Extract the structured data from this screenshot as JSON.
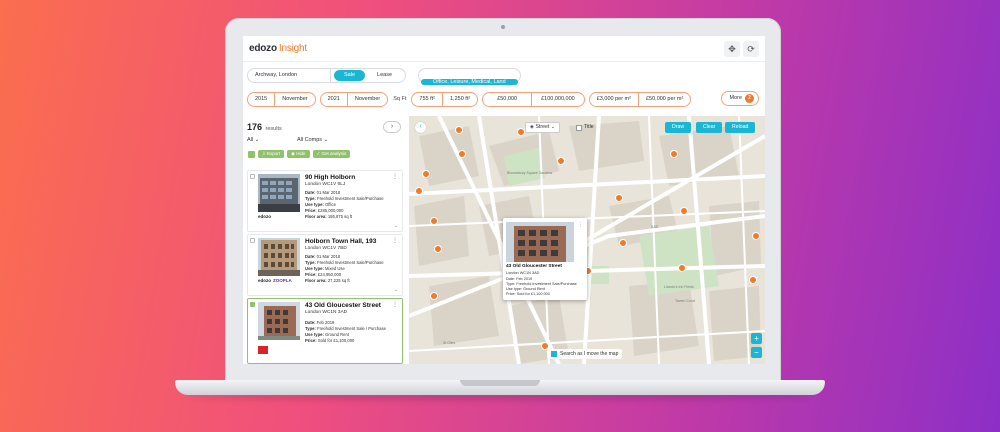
{
  "app": {
    "logo": "edozo",
    "logo_suffix": "Insight"
  },
  "header_buttons": [
    "✥",
    "⟳"
  ],
  "search": {
    "location": "Archway, London",
    "tabs": [
      "Sale",
      "Lease"
    ],
    "active_tab": "Sale",
    "property_types": "Office, Leisure, Medical, Land"
  },
  "filters": {
    "from_year": "2015",
    "from_month": "November",
    "to_year": "2021",
    "to_month": "November",
    "sqft_label": "Sq Ft",
    "sqft_min": "755 ft²",
    "sqft_max": "1,250 ft²",
    "price_min": "£50,000",
    "price_max": "£100,000,000",
    "rate_min": "£3,000 per m²",
    "rate_max": "£50,000 per m²",
    "more_label": "More",
    "more_count": "2"
  },
  "results": {
    "count": "176",
    "count_label": "results",
    "dropdown_all": "All",
    "dropdown_comps": "All Comps",
    "actions": [
      "Export",
      "Hide",
      "Get analysis"
    ],
    "cards": [
      {
        "title": "90 High Holborn",
        "subtitle": "London WC1V 6LJ",
        "date_label": "Date:",
        "date": "01 Mar 2018",
        "type_label": "Type:",
        "type": "Freehold Investment Sale/Purchase",
        "use_label": "Use type:",
        "use": "Office",
        "price_label": "Price:",
        "price": "£285,000,000",
        "area_label": "Floor area:",
        "area": "186,875 sq ft",
        "brand": "edozo",
        "brand2": ""
      },
      {
        "title": "Holborn Town Hall, 193",
        "subtitle": "London WC1V 7BD",
        "date_label": "Date:",
        "date": "01 Mar 2018",
        "type_label": "Type:",
        "type": "Freehold Investment Sale/Purchase",
        "use_label": "Use type:",
        "use": "Mixed Use",
        "price_label": "Price:",
        "price": "£24,950,000",
        "area_label": "Floor area:",
        "area": "27,225 sq ft",
        "brand": "edozo",
        "brand2": "ZOOPLA"
      },
      {
        "title": "43 Old Gloucester Street",
        "subtitle": "London WC1N 3AD",
        "date_label": "Date:",
        "date": "Feb 2019",
        "type_label": "Type:",
        "type": "Freehold Investment Sale / Purchase",
        "use_label": "Use type:",
        "use": "Ground Rent",
        "price_label": "Price:",
        "price": "Sold for £1,100,000",
        "area_label": "",
        "area": "",
        "brand": "",
        "brand2": ""
      }
    ]
  },
  "map": {
    "view": "Street",
    "title_toggle": "Title",
    "buttons": [
      "Draw",
      "Clear",
      "Reload"
    ],
    "search_as_move": "Search as I move the map",
    "zoom_in": "+",
    "zoom_out": "−",
    "labels": [
      "Bloomsbury Square Gardens",
      "Lincoln's Inn Fields",
      "Tavern Court",
      "St Giles",
      "SAD"
    ],
    "popup": {
      "title": "43 Old Gloucester Street",
      "subtitle": "London WC1N 3AD",
      "date": "Date: Feb 2019",
      "type": "Type: Freehold Investment Sale/Purchase",
      "use": "Use type: Ground Rent",
      "price": "Price: Sold for £1,100,000"
    }
  },
  "colors": {
    "accent": "#1ab6d4",
    "orange": "#f07a2c",
    "green": "#8fc26a",
    "map_bg": "#e8e4da",
    "park": "#cde3c3"
  }
}
